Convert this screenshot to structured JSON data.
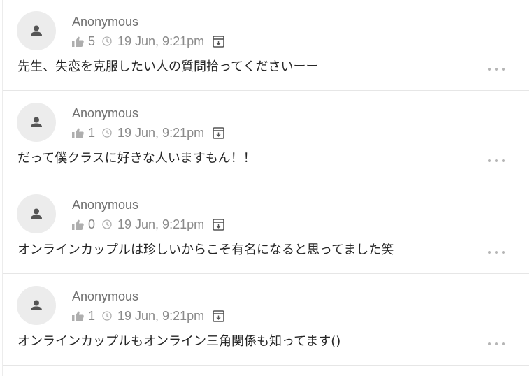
{
  "posts": [
    {
      "author": "Anonymous",
      "likes": "5",
      "timestamp": "19 Jun, 9:21pm",
      "text": "先生、失恋を克服したい人の質問拾ってくださいーー"
    },
    {
      "author": "Anonymous",
      "likes": "1",
      "timestamp": "19 Jun, 9:21pm",
      "text": "だって僕クラスに好きな人いますもん！！"
    },
    {
      "author": "Anonymous",
      "likes": "0",
      "timestamp": "19 Jun, 9:21pm",
      "text": "オンラインカップルは珍しいからこそ有名になると思ってました笑"
    },
    {
      "author": "Anonymous",
      "likes": "1",
      "timestamp": "19 Jun, 9:21pm",
      "text": "オンラインカップルもオンライン三角関係も知ってます()"
    }
  ],
  "icons": {
    "avatar": "person-icon",
    "likes": "thumbs-up-icon",
    "time": "clock-icon",
    "archive": "archive-box-icon",
    "menu": "more-horizontal-icon"
  },
  "colors": {
    "accent": "#5b8ed6",
    "avatar_bg": "#ececec",
    "meta_text": "#8a8a8a",
    "body_text": "#262626"
  }
}
